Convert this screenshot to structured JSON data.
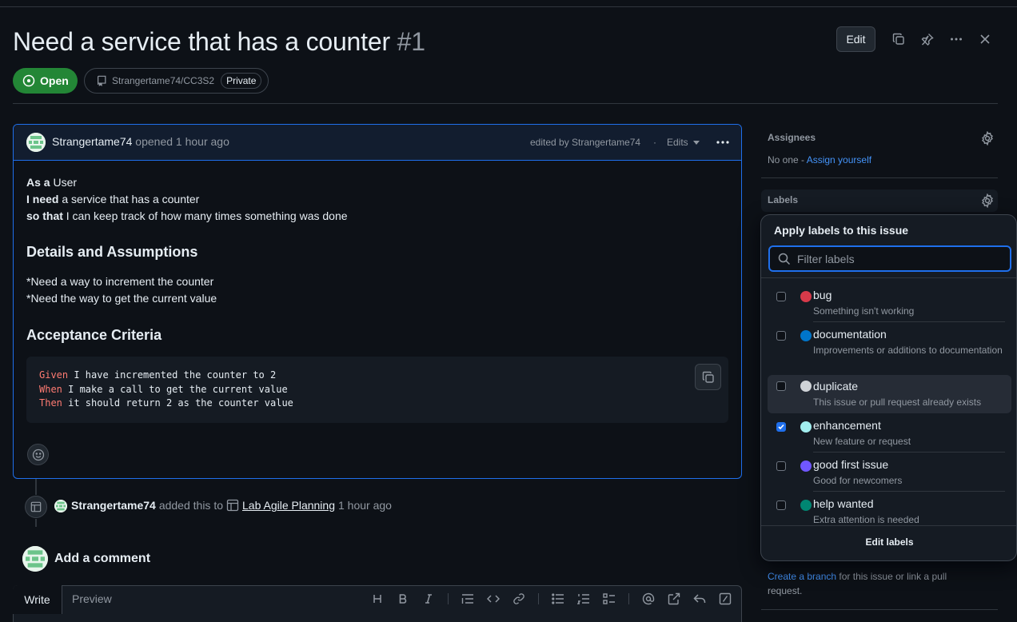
{
  "issue": {
    "title": "Need a service that has a counter",
    "number": "#1",
    "state": "Open",
    "repo": "Strangertame74/CC3S2",
    "visibility": "Private",
    "edit_label": "Edit"
  },
  "comment": {
    "author": "Strangertame74",
    "opened_text": "opened",
    "time": "1 hour ago",
    "edited_by": "edited by Strangertame74",
    "edits_label": "Edits",
    "body": {
      "line1_bold": "As a",
      "line1_rest": " User",
      "line2_bold": "I need",
      "line2_rest": " a service that has a counter",
      "line3_bold": "so that",
      "line3_rest": " I can keep track of how many times something was done",
      "heading1": "Details and Assumptions",
      "detail1": "*Need a way to increment the counter",
      "detail2": "*Need the way to get the current value",
      "heading2": "Acceptance Criteria",
      "code": [
        {
          "kw": "Given",
          "rest": " I have incremented the counter to 2"
        },
        {
          "kw": "When",
          "rest": " I make a call to get the current value"
        },
        {
          "kw": "Then",
          "rest": " it should return 2 as the counter value"
        }
      ]
    }
  },
  "timeline": {
    "actor": "Strangertame74",
    "action": "added this to",
    "project": "Lab Agile Planning",
    "time": "1 hour ago"
  },
  "add_comment": {
    "heading": "Add a comment",
    "tab_write": "Write",
    "tab_preview": "Preview"
  },
  "sidebar": {
    "assignees_label": "Assignees",
    "assignees_none": "No one - ",
    "assign_yourself": "Assign yourself",
    "labels_label": "Labels",
    "create_branch": "Create a branch",
    "branch_rest": " for this issue or link a pull",
    "branch_rest2": "request."
  },
  "labels_dropdown": {
    "title": "Apply labels to this issue",
    "filter_placeholder": "Filter labels",
    "edit_labels": "Edit labels",
    "items": [
      {
        "name": "bug",
        "desc": "Something isn't working",
        "color": "#d73a4a",
        "checked": false
      },
      {
        "name": "documentation",
        "desc": "Improvements or additions to documentation",
        "color": "#0075ca",
        "checked": false
      },
      {
        "name": "duplicate",
        "desc": "This issue or pull request already exists",
        "color": "#cfd3d7",
        "checked": false
      },
      {
        "name": "enhancement",
        "desc": "New feature or request",
        "color": "#a2eeef",
        "checked": true
      },
      {
        "name": "good first issue",
        "desc": "Good for newcomers",
        "color": "#7057ff",
        "checked": false
      },
      {
        "name": "help wanted",
        "desc": "Extra attention is needed",
        "color": "#008672",
        "checked": false
      }
    ]
  }
}
